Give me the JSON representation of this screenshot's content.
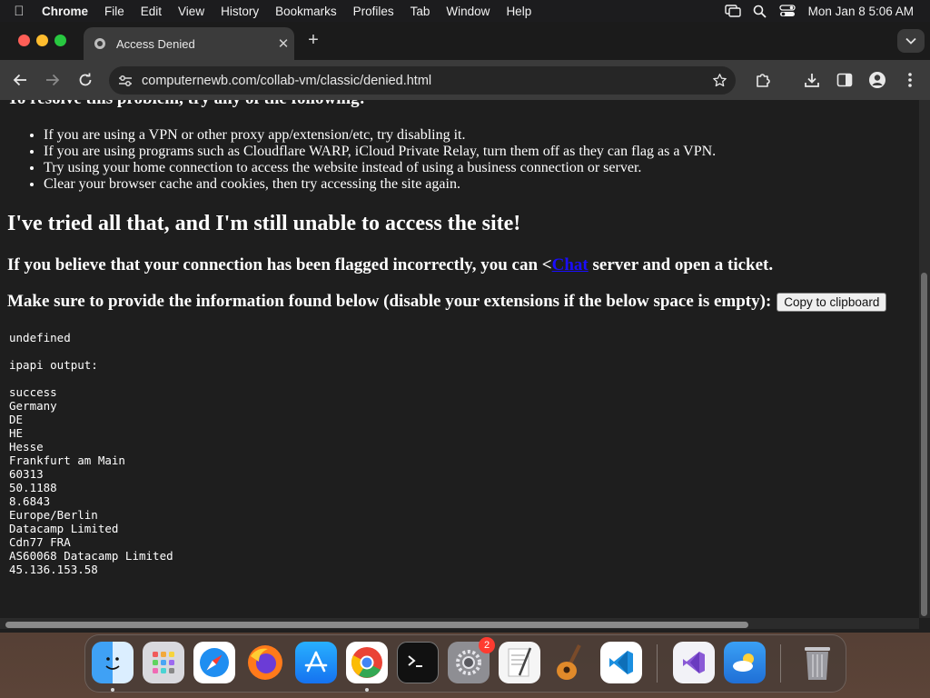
{
  "menubar": {
    "items": [
      "Chrome",
      "File",
      "Edit",
      "View",
      "History",
      "Bookmarks",
      "Profiles",
      "Tab",
      "Window",
      "Help"
    ],
    "clock": "Mon Jan 8  5:06 AM",
    "status_icons": [
      "screen-mirroring-icon",
      "spotlight-search-icon",
      "control-center-icon"
    ]
  },
  "browser": {
    "tab_title": "Access Denied",
    "url": "computernewb.com/collab-vm/classic/denied.html"
  },
  "page": {
    "partial_heading": "To resolve this problem, try any of the following:",
    "tips": [
      "If you are using a VPN or other proxy app/extension/etc, try disabling it.",
      "If you are using programs such as Cloudflare WARP, iCloud Private Relay, turn them off as they can flag as a VPN.",
      "Try using your home connection to access the website instead of using a business connection or server.",
      "Clear your browser cache and cookies, then try accessing the site again."
    ],
    "heading_still_unable": "I've tried all that, and I'm still unable to access the site!",
    "flagged_prefix": "If you believe that your connection has been flagged incorrectly, you can <",
    "flagged_link": "Chat",
    "flagged_suffix": " server and open a ticket.",
    "info_prompt": "Make sure to provide the information found below (disable your extensions if the below space is empty):",
    "copy_button": "Copy to clipboard",
    "info_output": "undefined\n\nipapi output:\n\nsuccess\nGermany\nDE\nHE\nHesse\nFrankfurt am Main\n60313\n50.1188\n8.6843\nEurope/Berlin\nDatacamp Limited\nCdn77 FRA\nAS60068 Datacamp Limited\n45.136.153.58"
  },
  "dock": {
    "apps": [
      "finder-icon",
      "launchpad-icon",
      "safari-icon",
      "firefox-icon",
      "app-store-icon",
      "chrome-icon",
      "terminal-icon",
      "system-settings-icon",
      "textedit-icon",
      "garageband-icon",
      "vscode-icon",
      "visual-studio-icon",
      "weather-icon",
      "trash-icon"
    ],
    "system_settings_badge": "2"
  },
  "colors": {
    "link": "#1a0dff",
    "page_background": "#1e1e1e",
    "toolbar": "#3b3b3b"
  }
}
